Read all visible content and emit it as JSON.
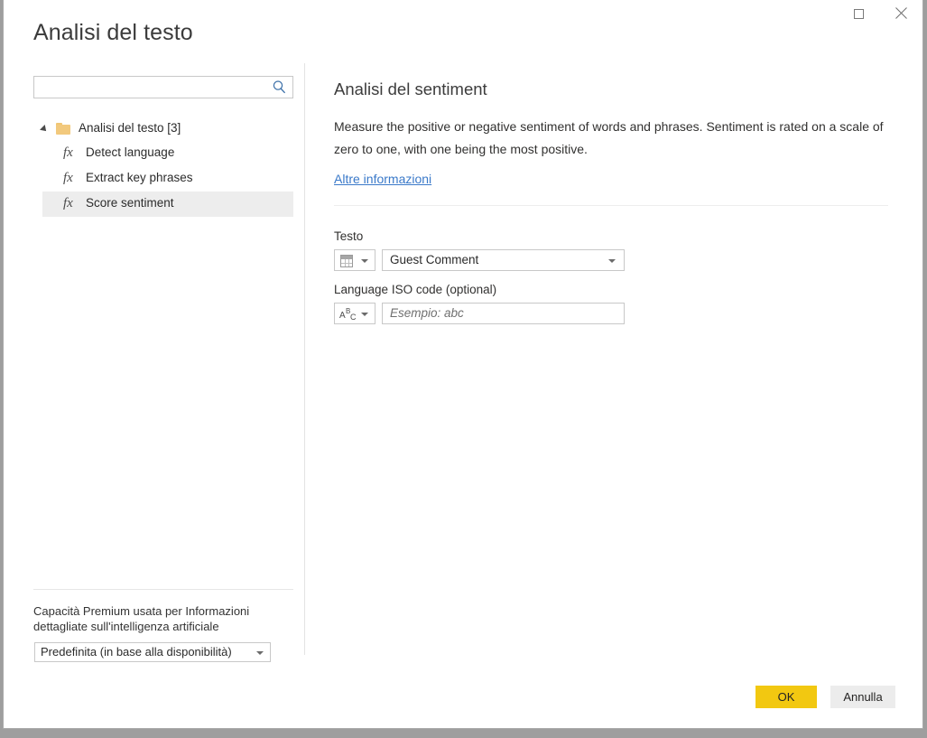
{
  "window": {
    "title": "Analisi del testo",
    "maximize_icon": "maximize-square-icon",
    "close_icon": "close-x-icon"
  },
  "sidebar": {
    "search": {
      "value": "",
      "placeholder": "",
      "icon": "search-icon"
    },
    "tree": {
      "root": {
        "label": "Analisi del testo [3]",
        "expander_icon": "expander-triangle-icon",
        "folder_icon": "folder-icon",
        "expanded": true
      },
      "items": [
        {
          "label": "Detect language",
          "icon": "fx-function-icon",
          "selected": false
        },
        {
          "label": "Extract key phrases",
          "icon": "fx-function-icon",
          "selected": false
        },
        {
          "label": "Score sentiment",
          "icon": "fx-function-icon",
          "selected": true
        }
      ]
    },
    "capacity": {
      "label": "Capacità Premium usata per Informazioni dettagliate sull'intelligenza artificiale",
      "selected": "Predefinita (in base alla disponibilità)",
      "caret_icon": "chevron-down-icon"
    }
  },
  "main": {
    "title": "Analisi del sentiment",
    "description": "Measure the positive or negative sentiment of words and phrases. Sentiment is rated on a scale of zero to one, with one being the most positive.",
    "link": "Altre informazioni",
    "fields": [
      {
        "label": "Testo",
        "type_icon": "table-column-icon",
        "type_caret_icon": "chevron-down-icon",
        "value": "Guest Comment",
        "placeholder": "",
        "value_caret_icon": "chevron-down-icon"
      },
      {
        "label": "Language ISO code (optional)",
        "type_icon": "abc-text-icon",
        "type_caret_icon": "chevron-down-icon",
        "value": "",
        "placeholder": "Esempio: abc",
        "value_caret_icon": ""
      }
    ]
  },
  "footer": {
    "ok_label": "OK",
    "cancel_label": "Annulla",
    "ok_color": "#f2c811",
    "cancel_color": "#ececec"
  }
}
